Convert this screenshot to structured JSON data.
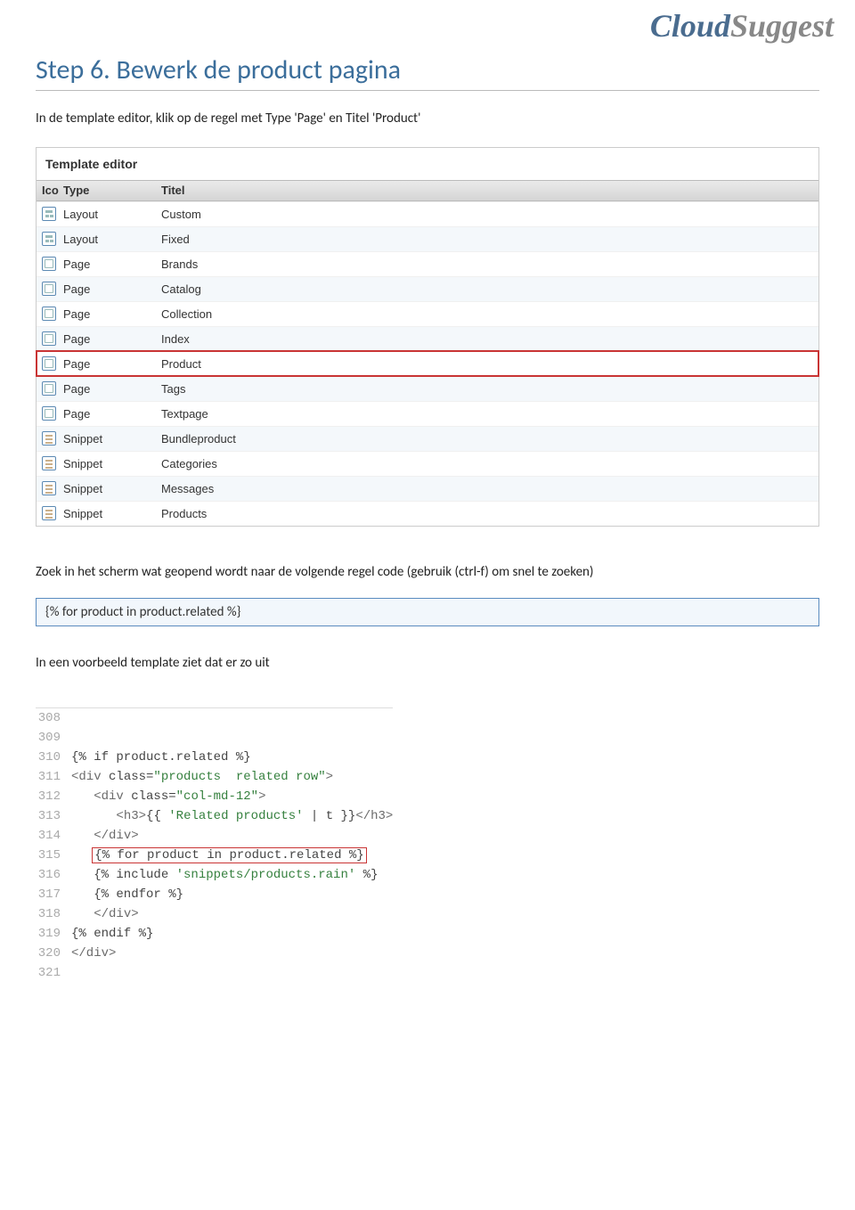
{
  "logo": {
    "part1": "Cloud",
    "part2": "Suggest"
  },
  "heading": "Step 6. Bewerk de product pagina",
  "intro": "In de template editor, klik op de regel met Type 'Page' en Titel 'Product'",
  "editor": {
    "title": "Template editor",
    "cols": {
      "ico": "Ico",
      "type": "Type",
      "title": "Titel"
    },
    "rows": [
      {
        "iconType": "layout",
        "type": "Layout",
        "title": "Custom",
        "alt": false,
        "hl": false
      },
      {
        "iconType": "layout",
        "type": "Layout",
        "title": "Fixed",
        "alt": true,
        "hl": false
      },
      {
        "iconType": "page",
        "type": "Page",
        "title": "Brands",
        "alt": false,
        "hl": false
      },
      {
        "iconType": "page",
        "type": "Page",
        "title": "Catalog",
        "alt": true,
        "hl": false
      },
      {
        "iconType": "page",
        "type": "Page",
        "title": "Collection",
        "alt": false,
        "hl": false
      },
      {
        "iconType": "page",
        "type": "Page",
        "title": "Index",
        "alt": true,
        "hl": false
      },
      {
        "iconType": "page",
        "type": "Page",
        "title": "Product",
        "alt": false,
        "hl": true
      },
      {
        "iconType": "page",
        "type": "Page",
        "title": "Tags",
        "alt": true,
        "hl": false
      },
      {
        "iconType": "page",
        "type": "Page",
        "title": "Textpage",
        "alt": false,
        "hl": false
      },
      {
        "iconType": "snippet",
        "type": "Snippet",
        "title": "Bundleproduct",
        "alt": true,
        "hl": false
      },
      {
        "iconType": "snippet",
        "type": "Snippet",
        "title": "Categories",
        "alt": false,
        "hl": false
      },
      {
        "iconType": "snippet",
        "type": "Snippet",
        "title": "Messages",
        "alt": true,
        "hl": false
      },
      {
        "iconType": "snippet",
        "type": "Snippet",
        "title": "Products",
        "alt": false,
        "hl": false
      }
    ]
  },
  "midtext": "Zoek in het scherm wat geopend wordt naar de volgende regel code (gebruik (ctrl-f) om snel te zoeken)",
  "codesearch": "{% for product in product.related %}",
  "exampletext": "In een voorbeeld template ziet dat er zo uit",
  "code": {
    "lines": [
      {
        "n": "308",
        "raw": "",
        "hl": false
      },
      {
        "n": "309",
        "raw": "",
        "hl": false
      },
      {
        "n": "310",
        "raw": "{% if product.related %}",
        "hl": false
      },
      {
        "n": "311",
        "raw": "<div class=\"products  related row\">",
        "hl": false
      },
      {
        "n": "312",
        "raw": "   <div class=\"col-md-12\">",
        "hl": false
      },
      {
        "n": "313",
        "raw": "      <h3>{{ 'Related products' | t }}</h3>",
        "hl": false
      },
      {
        "n": "314",
        "raw": "   </div>",
        "hl": false
      },
      {
        "n": "315",
        "raw": "   {% for product in product.related %}",
        "hl": true
      },
      {
        "n": "316",
        "raw": "   {% include 'snippets/products.rain' %}",
        "hl": false
      },
      {
        "n": "317",
        "raw": "   {% endfor %}",
        "hl": false
      },
      {
        "n": "318",
        "raw": "   </div>",
        "hl": false
      },
      {
        "n": "319",
        "raw": "{% endif %}",
        "hl": false
      },
      {
        "n": "320",
        "raw": "</div>",
        "hl": false
      },
      {
        "n": "321",
        "raw": "",
        "hl": false
      }
    ]
  }
}
